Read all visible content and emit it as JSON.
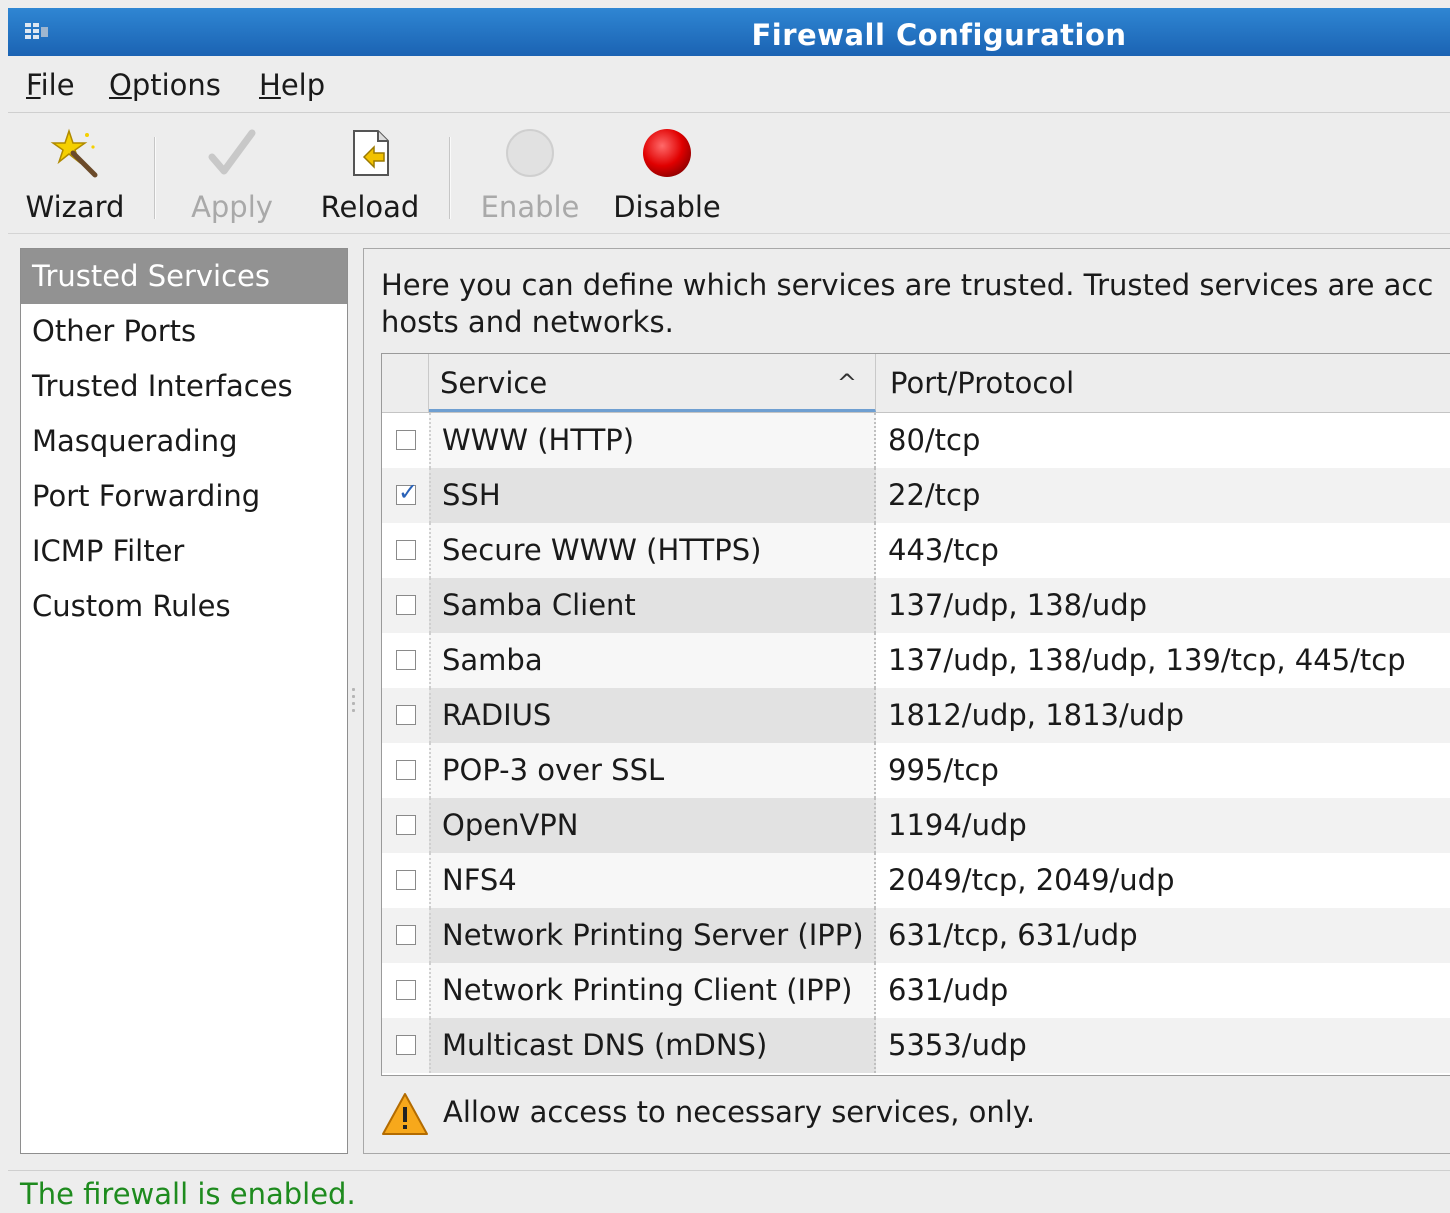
{
  "window": {
    "title": "Firewall Configuration"
  },
  "menu": [
    {
      "label": "File",
      "mnemonic": "F",
      "rest": "ile"
    },
    {
      "label": "Options",
      "mnemonic": "O",
      "rest": "ptions"
    },
    {
      "label": "Help",
      "mnemonic": "H",
      "rest": "elp"
    }
  ],
  "toolbar": {
    "wizard": {
      "label": "Wizard",
      "icon": "wizard-wand-icon",
      "enabled": true
    },
    "apply": {
      "label": "Apply",
      "icon": "checkmark-icon",
      "enabled": false
    },
    "reload": {
      "label": "Reload",
      "icon": "reload-icon",
      "enabled": true
    },
    "enable": {
      "label": "Enable",
      "icon": "grey-circle-icon",
      "enabled": false
    },
    "disable": {
      "label": "Disable",
      "icon": "red-circle-icon",
      "enabled": true
    }
  },
  "nav": {
    "items": [
      "Trusted Services",
      "Other Ports",
      "Trusted Interfaces",
      "Masquerading",
      "Port Forwarding",
      "ICMP Filter",
      "Custom Rules"
    ],
    "selected": "Trusted Services"
  },
  "panel": {
    "description_line1": "Here you can define which services are trusted. Trusted services are acc",
    "description_line2": "hosts and networks.",
    "columns": {
      "service": "Service",
      "port": "Port/Protocol"
    },
    "rows": [
      {
        "service": "WWW (HTTP)",
        "port": "80/tcp",
        "checked": false
      },
      {
        "service": "SSH",
        "port": "22/tcp",
        "checked": true
      },
      {
        "service": "Secure WWW (HTTPS)",
        "port": "443/tcp",
        "checked": false
      },
      {
        "service": "Samba Client",
        "port": "137/udp, 138/udp",
        "checked": false
      },
      {
        "service": "Samba",
        "port": "137/udp, 138/udp, 139/tcp, 445/tcp",
        "checked": false
      },
      {
        "service": "RADIUS",
        "port": "1812/udp, 1813/udp",
        "checked": false
      },
      {
        "service": "POP-3 over SSL",
        "port": "995/tcp",
        "checked": false
      },
      {
        "service": "OpenVPN",
        "port": "1194/udp",
        "checked": false
      },
      {
        "service": "NFS4",
        "port": "2049/tcp, 2049/udp",
        "checked": false
      },
      {
        "service": "Network Printing Server (IPP)",
        "port": "631/tcp, 631/udp",
        "checked": false
      },
      {
        "service": "Network Printing Client (IPP)",
        "port": "631/udp",
        "checked": false
      },
      {
        "service": "Multicast DNS (mDNS)",
        "port": "5353/udp",
        "checked": false
      }
    ],
    "warning": "Allow access to necessary services, only."
  },
  "status": {
    "text": "The firewall is enabled.",
    "color": "#1e8b1e"
  },
  "colors": {
    "titlebar": "#1b63b3",
    "selection": "#929292",
    "disable_red": "#d40000"
  }
}
